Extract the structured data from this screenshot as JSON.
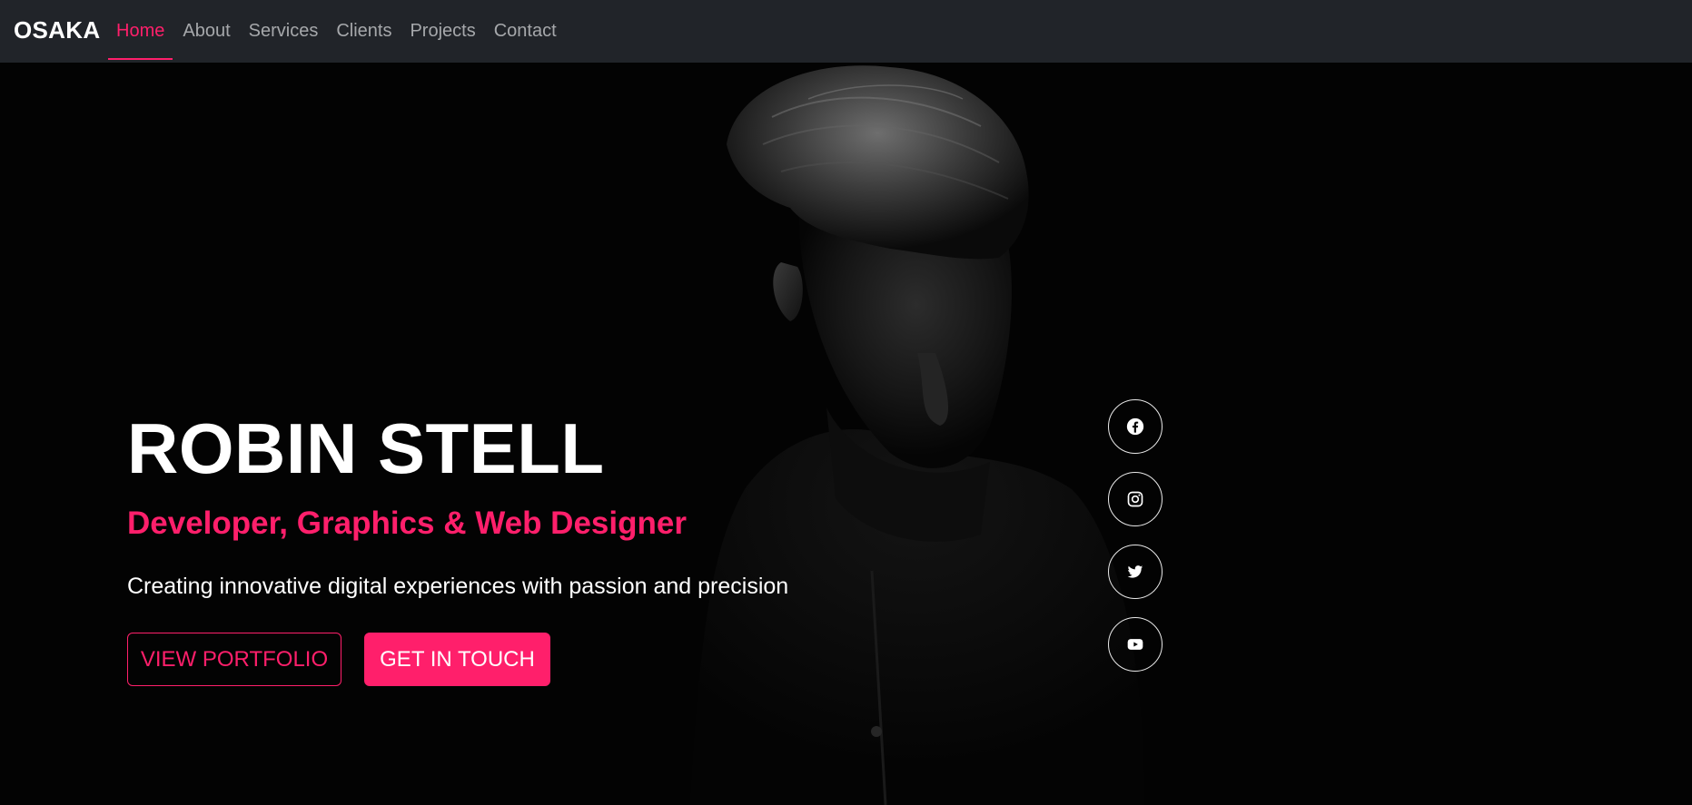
{
  "nav": {
    "brand": "OSAKA",
    "links": [
      {
        "label": "Home",
        "active": true
      },
      {
        "label": "About",
        "active": false
      },
      {
        "label": "Services",
        "active": false
      },
      {
        "label": "Clients",
        "active": false
      },
      {
        "label": "Projects",
        "active": false
      },
      {
        "label": "Contact",
        "active": false
      }
    ]
  },
  "hero": {
    "name": "ROBIN STELL",
    "role": "Developer, Graphics & Web Designer",
    "tagline": "Creating innovative digital experiences with passion and precision",
    "buttons": {
      "portfolio": "VIEW PORTFOLIO",
      "contact": "GET IN TOUCH"
    }
  },
  "social": [
    {
      "icon": "facebook-icon"
    },
    {
      "icon": "instagram-icon"
    },
    {
      "icon": "twitter-icon"
    },
    {
      "icon": "youtube-icon"
    }
  ],
  "colors": {
    "accent": "#ff1f6b",
    "navbar_bg": "#212429",
    "page_bg": "#030303",
    "nav_link": "#a6a8ab",
    "text_light": "#ffffff"
  }
}
